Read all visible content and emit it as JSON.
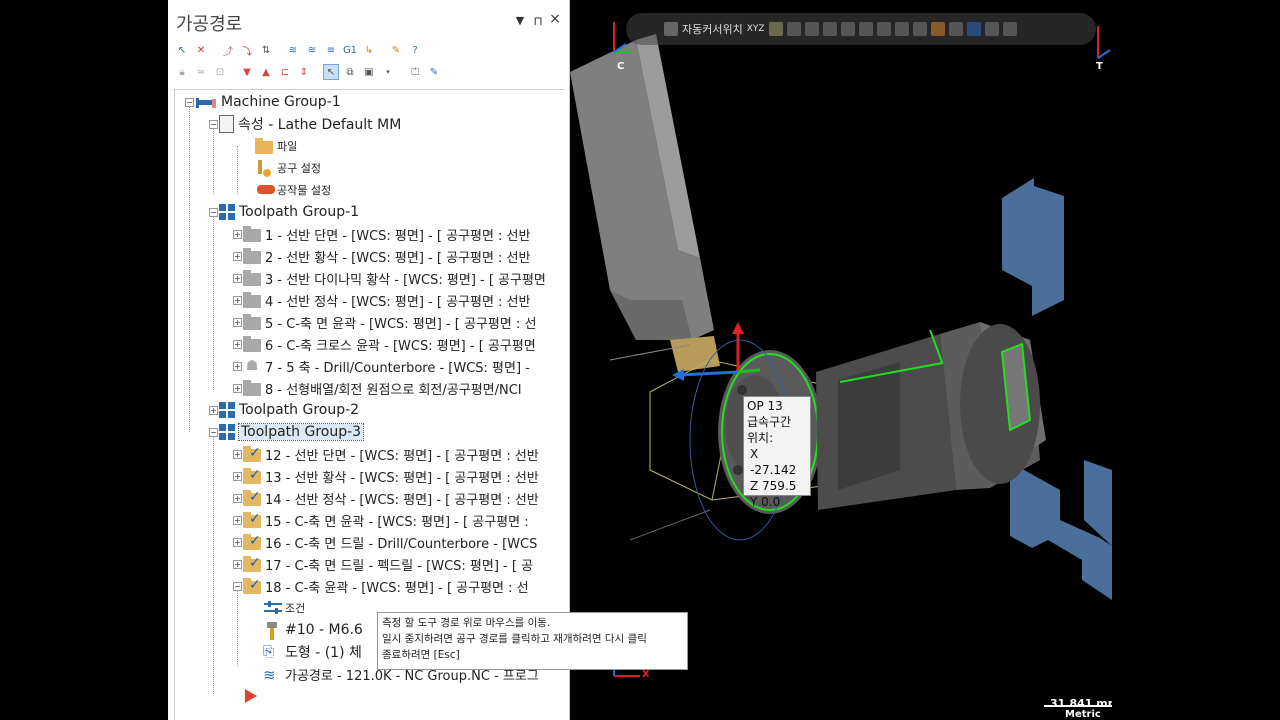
{
  "panel": {
    "title": "가공경로",
    "pin_symbol": "▼",
    "pin_icon_text": "ᵖ",
    "close_symbol": "×"
  },
  "tree": {
    "machine_group": "Machine Group-1",
    "properties": "속성 - Lathe Default MM",
    "files": "파일",
    "tool_settings": "공구 설정",
    "stock_settings": "공작물 설정",
    "tp_group1": "Toolpath Group-1",
    "ops1": [
      "1 - 선반 단면 - [WCS: 평면] - [ 공구평면 : 선반",
      "2 - 선반 황삭 - [WCS: 평면] - [ 공구평면 : 선반",
      "3 - 선반 다이나믹 황삭 - [WCS: 평면] - [ 공구평면",
      "4 - 선반 정삭 - [WCS: 평면] - [ 공구평면 : 선반",
      "5 - C-축 면 윤곽 - [WCS: 평면] - [ 공구평면 : 선",
      "6 - C-축 크로스 윤곽 - [WCS: 평면] - [ 공구평면",
      "7 - 5 축 - Drill/Counterbore - [WCS: 평면] -",
      "8 - 선형배열/회전 원점으로 회전/공구평면/NCI"
    ],
    "tp_group2": "Toolpath Group-2",
    "tp_group3": "Toolpath Group-3",
    "ops3": [
      "12 - 선반 단면 - [WCS: 평면] - [ 공구평면 : 선반",
      "13 - 선반 황삭 - [WCS: 평면] - [ 공구평면 : 선반",
      "14 - 선반 정삭 - [WCS: 평면] - [ 공구평면 : 선반",
      "15 - C-축 면 윤곽 - [WCS: 평면] - [ 공구평면 :",
      "16 - C-축 면 드릴 - Drill/Counterbore - [WCS",
      "17 - C-축 면 드릴 - 펙드릴 - [WCS: 평면] - [ 공",
      "18 - C-축 윤곽 - [WCS: 평면] - [ 공구평면 : 선"
    ],
    "op18_children": {
      "params": "조건",
      "tool": "#10 - M6.6",
      "geometry": "도형 - (1) 체",
      "toolpath": "가공경로 - 121.0K - NC Group.NC - 프로그"
    }
  },
  "viewport": {
    "toolbar_label": "자동커서위치",
    "xyz_label": "XYZ",
    "axis_c": "C",
    "axis_t": "T",
    "op_info": {
      "op": "OP 13",
      "mode": "급속구간",
      "pos_label": "위치:",
      "x": "X -27.142",
      "z": "Z 759.5",
      "y": "Y 0.0"
    },
    "hint": {
      "line1": "측정 할 도구 경로 위로 마우스를 이동.",
      "line2": "일시 중지하려면 공구 경로를 클릭하고 재개하려면 다시 클릭",
      "line3": "종료하려면 [Esc]"
    },
    "scale": "31.841 mm",
    "units": "Metric"
  },
  "colors": {
    "accent_blue": "#2b6cb0",
    "tool_gray": "#8a8a8a",
    "fixture_blue": "#4a6f9a",
    "edge_green": "#22dd22"
  }
}
